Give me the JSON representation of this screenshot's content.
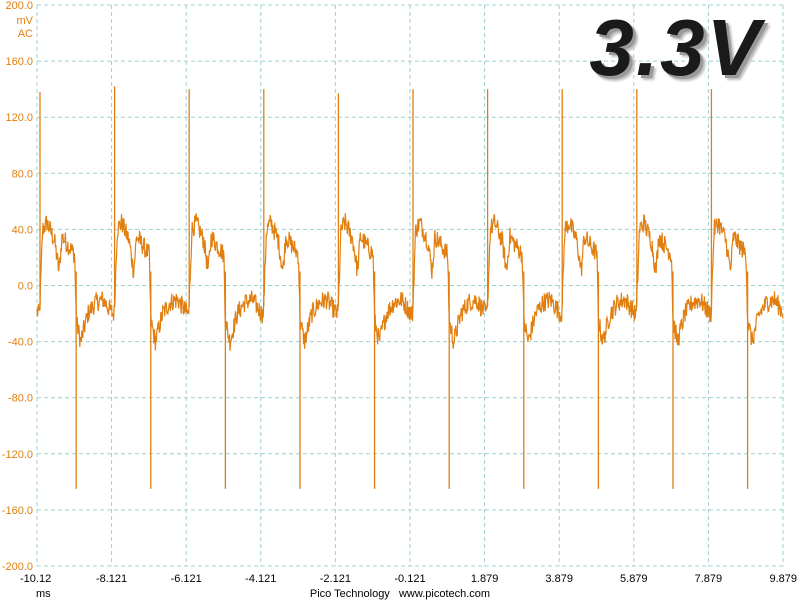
{
  "chart_data": {
    "type": "line",
    "title": "3.3V",
    "y_unit": "mV",
    "y_coupling": "AC",
    "x_unit": "ms",
    "ylim": [
      -200.0,
      200.0
    ],
    "xlim": [
      -10.12,
      9.879
    ],
    "y_ticks": [
      "200.0",
      "160.0",
      "120.0",
      "80.0",
      "40.0",
      "0.0",
      "-40.0",
      "-80.0",
      "-120.0",
      "-160.0",
      "-200.0"
    ],
    "x_ticks": [
      "-10.12",
      "-8.121",
      "-6.121",
      "-4.121",
      "-2.121",
      "-0.121",
      "1.879",
      "3.879",
      "5.879",
      "7.879",
      "9.879"
    ],
    "grid": true,
    "series": [
      {
        "color": "#e07f10",
        "period_ms": 2.0,
        "events": [
          {
            "kind": "positive_spike",
            "peak": 140
          },
          {
            "kind": "negative_spike",
            "trough": -145
          }
        ],
        "spike_peaks": [
          138,
          142,
          140,
          140,
          137,
          140,
          140,
          140,
          140,
          140
        ],
        "cycle_shape": [
          {
            "phase": 0.0,
            "value": -20
          },
          {
            "phase": 0.04,
            "value": 40
          },
          {
            "phase": 0.1,
            "value": 45
          },
          {
            "phase": 0.2,
            "value": 32
          },
          {
            "phase": 0.26,
            "value": 10
          },
          {
            "phase": 0.3,
            "value": 35
          },
          {
            "phase": 0.47,
            "value": 22
          },
          {
            "phase": 0.49,
            "value": -25
          },
          {
            "phase": 0.55,
            "value": -40
          },
          {
            "phase": 0.65,
            "value": -20
          },
          {
            "phase": 0.75,
            "value": -12
          },
          {
            "phase": 0.85,
            "value": -10
          },
          {
            "phase": 0.98,
            "value": -20
          }
        ]
      }
    ]
  },
  "footer": {
    "brand": "Pico Technology",
    "website": "www.picotech.com"
  }
}
